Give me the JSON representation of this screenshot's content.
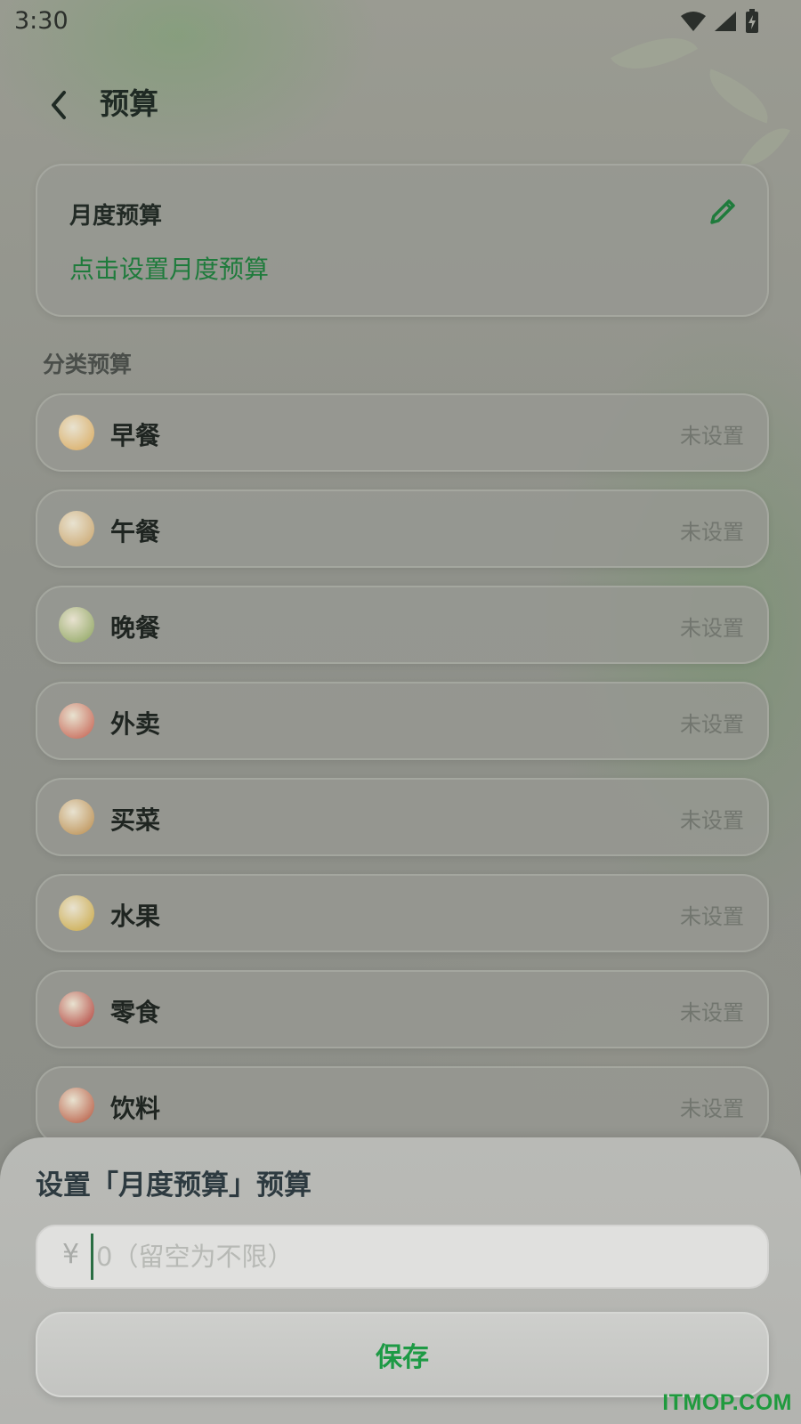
{
  "status_bar": {
    "time": "3:30"
  },
  "header": {
    "title": "预算"
  },
  "monthly_budget": {
    "title": "月度预算",
    "link": "点击设置月度预算"
  },
  "category_section": {
    "title": "分类预算"
  },
  "categories": [
    {
      "name": "早餐",
      "status": "未设置",
      "icon": "breakfast-icon",
      "color": "#d9a85a"
    },
    {
      "name": "午餐",
      "status": "未设置",
      "icon": "lunch-icon",
      "color": "#c9a36a"
    },
    {
      "name": "晚餐",
      "status": "未设置",
      "icon": "dinner-icon",
      "color": "#8aa35c"
    },
    {
      "name": "外卖",
      "status": "未设置",
      "icon": "takeout-icon",
      "color": "#c45a4a"
    },
    {
      "name": "买菜",
      "status": "未设置",
      "icon": "groceries-icon",
      "color": "#b98a4a"
    },
    {
      "name": "水果",
      "status": "未设置",
      "icon": "fruit-icon",
      "color": "#c9a640"
    },
    {
      "name": "零食",
      "status": "未设置",
      "icon": "snack-icon",
      "color": "#b03a35"
    },
    {
      "name": "饮料",
      "status": "未设置",
      "icon": "drink-icon",
      "color": "#b5523a"
    }
  ],
  "sheet": {
    "title": "设置「月度预算」预算",
    "currency": "¥",
    "amount_value": "",
    "placeholder": "0（留空为不限）",
    "save_label": "保存"
  },
  "watermark": "ITMOP.COM",
  "colors": {
    "accent": "#1e9a45",
    "link": "#1f7b3c"
  }
}
